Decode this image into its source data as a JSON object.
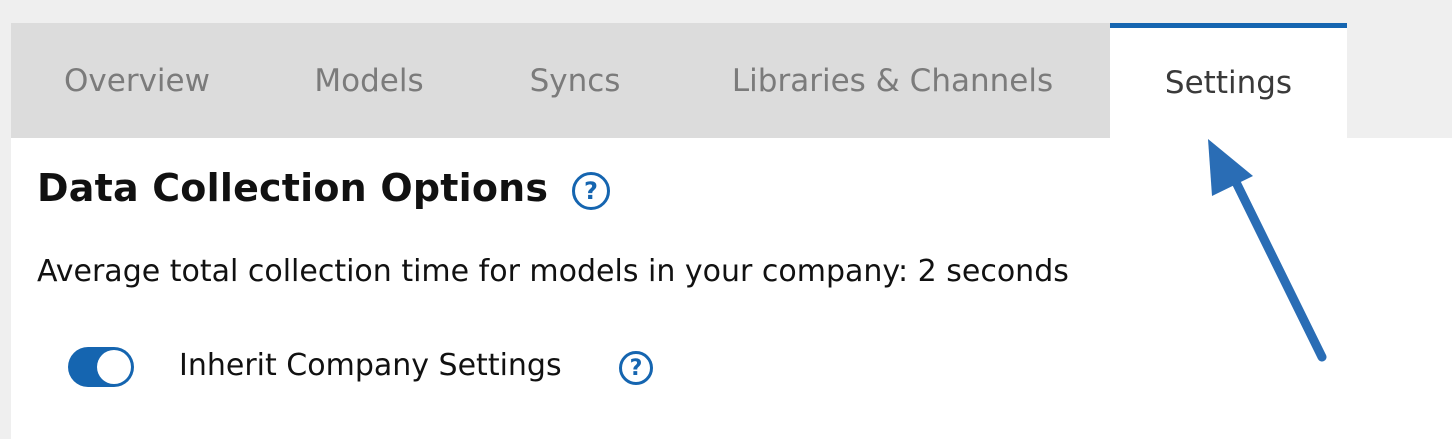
{
  "tabs": [
    {
      "label": "Overview"
    },
    {
      "label": "Models"
    },
    {
      "label": "Syncs"
    },
    {
      "label": "Libraries & Channels"
    },
    {
      "label": "Settings",
      "active": true
    }
  ],
  "section": {
    "title": "Data Collection Options",
    "average_text": "Average total collection time for models in your company: 2 seconds"
  },
  "inherit_toggle": {
    "label": "Inherit Company Settings",
    "enabled": true
  },
  "help_icon_glyph": "?",
  "colors": {
    "accent": "#1565b0",
    "tabbar_bg": "#dcdcdc",
    "annotation_arrow": "#2a6db5"
  }
}
